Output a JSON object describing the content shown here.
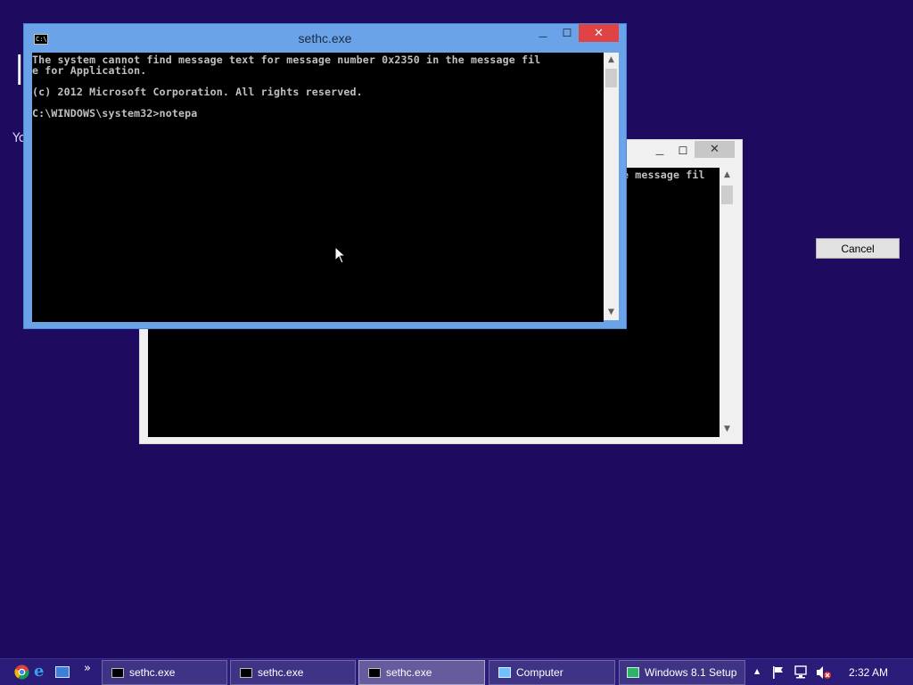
{
  "background": {
    "color": "#1e0a5e",
    "fragment_text": "Yo",
    "cursor_glyph": "|"
  },
  "setup_dialog": {
    "cancel_label": "Cancel"
  },
  "front_window": {
    "title": "sethc.exe",
    "title_bar_color": "#6aa3e8",
    "console_lines": [
      "The system cannot find message text for message number 0x2350 in the message fil",
      "e for Application.",
      "",
      "(c) 2012 Microsoft Corporation. All rights reserved.",
      "",
      "C:\\WINDOWS\\system32>notepa"
    ],
    "minimize_glyph": "—",
    "maximize_glyph": "☐",
    "close_glyph": "✕"
  },
  "back_window": {
    "console_fragment": "e message fil",
    "minimize_glyph": "—",
    "maximize_glyph": "☐",
    "close_glyph": "✕"
  },
  "taskbar": {
    "overflow_glyph": "»",
    "buttons": [
      {
        "label": "sethc.exe",
        "icon": "cmd-icon",
        "active": false
      },
      {
        "label": "sethc.exe",
        "icon": "cmd-icon",
        "active": false
      },
      {
        "label": "sethc.exe",
        "icon": "cmd-icon",
        "active": true
      },
      {
        "label": "Computer",
        "icon": "computer-icon",
        "active": false
      },
      {
        "label": "Windows 8.1 Setup",
        "icon": "setup-icon",
        "active": false
      }
    ],
    "tray_up_glyph": "▲",
    "clock": "2:32 AM"
  }
}
